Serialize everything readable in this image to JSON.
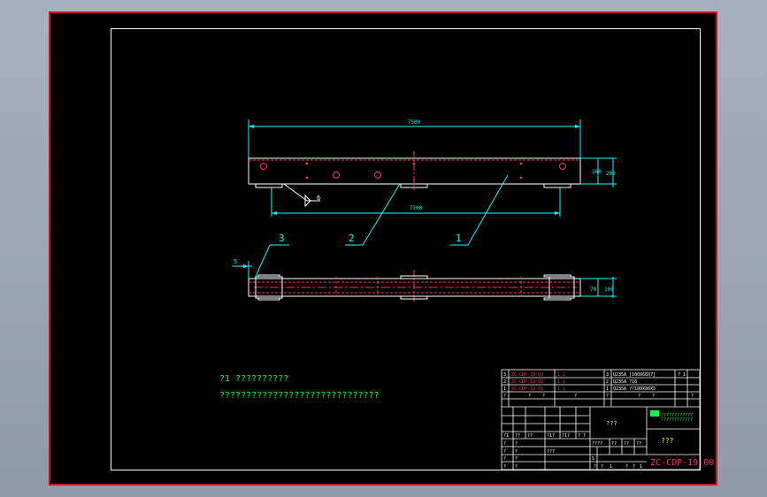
{
  "drawing": {
    "dims": {
      "overall_length": "7500",
      "inner_span": "7300",
      "height_inner": "160",
      "height_outer": "200",
      "bottom_height": "70",
      "bottom_height_outer": "100",
      "offset": "5",
      "weld_symbol": "6"
    },
    "callouts": [
      "1",
      "2",
      "3"
    ],
    "notes": [
      "?1 ??????????",
      "??????????????????????????????"
    ]
  },
  "title_block": {
    "parts": [
      {
        "no": "3",
        "code": "ZC-CDP-19-03",
        "qty": "1 2",
        "mat": "Q235A  [100X68X7]",
        "note": "? 1"
      },
      {
        "no": "2",
        "code": "ZC-CDP-19-02",
        "qty": "1 1",
        "mat": "Q235A  ?16",
        "note": ""
      },
      {
        "no": "1",
        "code": "ZC-CDP-19-01",
        "qty": "1 1",
        "mat": "Q235A  ??100X80X5",
        "note": ""
      }
    ],
    "header_row": [
      "?",
      "?",
      "?",
      "?",
      "?",
      "?",
      "?",
      "?"
    ],
    "name_marks": "???",
    "company": "????????????",
    "drawing_name": "???",
    "rev_row": [
      "?1",
      "??",
      "??",
      "?1?",
      "?1?",
      "?",
      "?"
    ],
    "scale_row": [
      "????",
      "??",
      "??",
      "??"
    ],
    "sign_rows": [
      [
        "?",
        "?"
      ],
      [
        "?",
        "?",
        "???"
      ],
      [
        "?",
        "?"
      ],
      [
        "?",
        "?"
      ]
    ],
    "sheet_row": [
      "?",
      "?",
      "1",
      "?",
      "?",
      "1"
    ],
    "drawing_no": "ZC-CDP-19-00",
    "mark": "S"
  }
}
